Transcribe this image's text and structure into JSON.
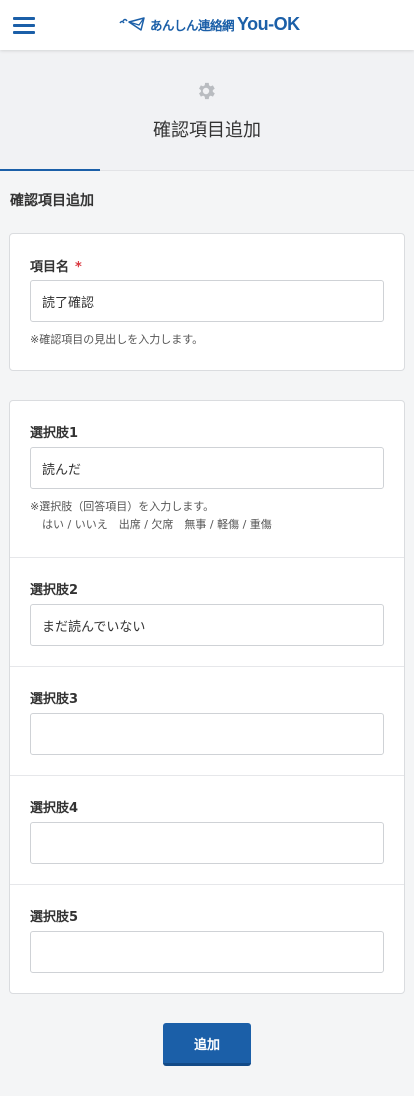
{
  "header": {
    "logo_text_jp": "あんしん連絡網",
    "logo_text_en": "You-OK"
  },
  "page": {
    "title": "確認項目追加",
    "section_heading": "確認項目追加"
  },
  "item_name": {
    "label": "項目名",
    "required_mark": "*",
    "value": "読了確認",
    "help": "※確認項目の見出しを入力します。"
  },
  "choices": [
    {
      "label": "選択肢1",
      "value": "読んだ"
    },
    {
      "label": "選択肢2",
      "value": "まだ読んでいない"
    },
    {
      "label": "選択肢3",
      "value": ""
    },
    {
      "label": "選択肢4",
      "value": ""
    },
    {
      "label": "選択肢5",
      "value": ""
    }
  ],
  "choices_help": {
    "line1": "※選択肢（回答項目）を入力します。",
    "line2": "はい / いいえ　出席 / 欠席　無事 / 軽傷 / 重傷"
  },
  "buttons": {
    "add": "追加"
  },
  "colors": {
    "accent": "#1b5fa8",
    "required": "#d9363e",
    "background": "#f4f5f6"
  }
}
